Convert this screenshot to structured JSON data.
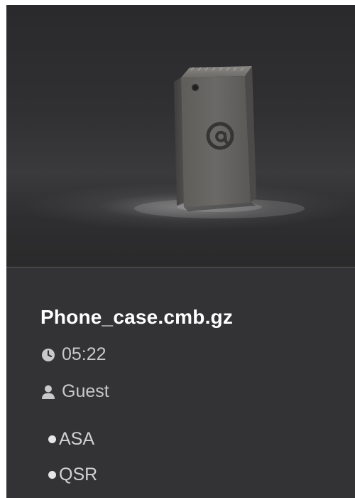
{
  "file": {
    "name": "Phone_case.cmb.gz",
    "duration": "05:22",
    "owner": "Guest",
    "tags": [
      "ASA",
      "QSR"
    ]
  },
  "icons": {
    "duration": "clock-icon",
    "owner": "user-icon",
    "tag": "bullet"
  },
  "colors": {
    "card_background": "#333336",
    "preview_background": "#2e2e30",
    "title": "#ffffff",
    "meta_text": "#c9c9cc"
  }
}
